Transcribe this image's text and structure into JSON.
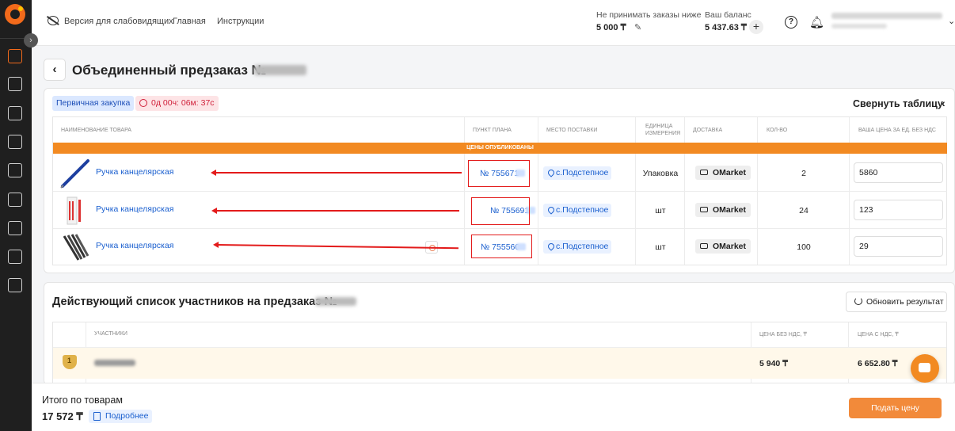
{
  "header": {
    "accessibility_label": "Версия для слабовидящих",
    "nav": [
      "Главная",
      "Инструкции"
    ],
    "min_order_label": "Не принимать заказы ниже",
    "min_order_value": "5 000 ₸",
    "balance_label": "Ваш баланс",
    "balance_value": "5 437.63 ₸"
  },
  "page": {
    "title": "Объединенный предзаказ №",
    "badge_type": "Первичная закупка",
    "timer": "0д 00ч: 06м: 37с",
    "collapse_label": "Свернуть таблицу"
  },
  "table": {
    "headers": [
      "Наименование товара",
      "Пункт плана",
      "Место поставки",
      "Единица измерения",
      "Доставка",
      "Кол-во",
      "Ваша цена за ед. без НДС"
    ],
    "status_bar": "Цены опубликованы",
    "rows": [
      {
        "name": "Ручка канцелярская",
        "plan": "№ 755671",
        "place": "с.Подстепное",
        "unit": "Упаковка",
        "delivery": "OMarket",
        "qty": "2",
        "price": "5860"
      },
      {
        "name": "Ручка канцелярская",
        "plan": "№ 755691",
        "place": "с.Подстепное",
        "unit": "шт",
        "delivery": "OMarket",
        "qty": "24",
        "price": "123"
      },
      {
        "name": "Ручка канцелярская",
        "plan": "№ 755560",
        "place": "с.Подстепное",
        "unit": "шт",
        "delivery": "OMarket",
        "qty": "100",
        "price": "29"
      }
    ]
  },
  "participants": {
    "title": "Действующий список участников на предзаказ №",
    "refresh_label": "Обновить результат",
    "headers": [
      "Участники",
      "Цена без НДС, ₸",
      "Цена с НДС, ₸"
    ],
    "rows": [
      {
        "place": "1",
        "price_no_vat": "5 940 ₸",
        "price_vat": "6 652.80 ₸"
      }
    ]
  },
  "footer": {
    "total_label": "Итого по товарам",
    "total_value": "17 572 ₸",
    "details_label": "Подробнее",
    "submit_label": "Подать цену"
  },
  "colors": {
    "accent": "#f28a22",
    "link": "#1a5fcf",
    "annotation": "#e31b1b",
    "sidebar": "#1f1f1f"
  }
}
